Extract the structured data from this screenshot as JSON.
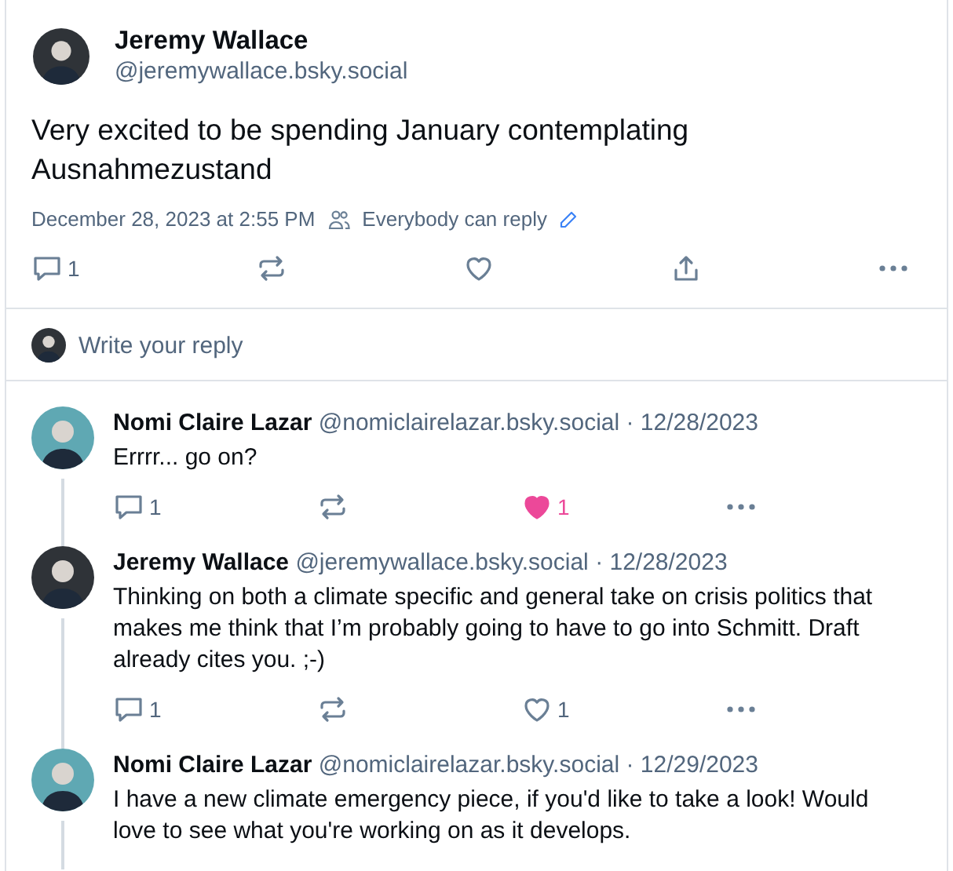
{
  "post": {
    "author": {
      "name": "Jeremy Wallace",
      "handle": "@jeremywallace.bsky.social",
      "avatar": {
        "color": "#2f3338"
      }
    },
    "text": "Very excited to be spending January contemplating Ausnahmezustand",
    "timestamp": "December 28, 2023 at 2:55 PM",
    "reply_setting": "Everybody can reply",
    "actions": {
      "replies": "1",
      "liked": false
    }
  },
  "reply_box": {
    "placeholder": "Write your reply",
    "avatar": {
      "color": "#2f3338"
    }
  },
  "replies": [
    {
      "author": {
        "name": "Nomi Claire Lazar",
        "handle": "@nomiclairelazar.bsky.social",
        "avatar": {
          "color": "#5fa8b3"
        }
      },
      "date": "· 12/28/2023",
      "text": "Errrr... go on?",
      "replies": "1",
      "likes": "1",
      "liked": true
    },
    {
      "author": {
        "name": "Jeremy Wallace",
        "handle": "@jeremywallace.bsky.social",
        "avatar": {
          "color": "#2f3338"
        }
      },
      "date": "· 12/28/2023",
      "text": "Thinking on both a climate specific and general take on crisis politics that makes me think that I’m probably going to have to go into Schmitt. Draft already cites you. ;-)",
      "replies": "1",
      "likes": "1",
      "liked": false
    },
    {
      "author": {
        "name": "Nomi Claire Lazar",
        "handle": "@nomiclairelazar.bsky.social",
        "avatar": {
          "color": "#5fa8b3"
        }
      },
      "date": "· 12/29/2023",
      "text": "I have a new climate emergency piece, if you'd like to take a look! Would love to see what you're working on as it develops."
    }
  ]
}
